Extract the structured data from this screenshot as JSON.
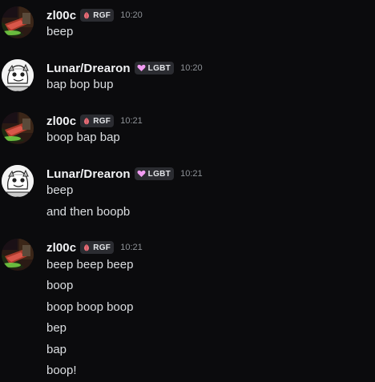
{
  "messages": [
    {
      "author": "zl00c",
      "tag": "RGF",
      "tag_icon": "peach-icon",
      "time": "10:20",
      "lines": [
        "beep"
      ]
    },
    {
      "author": "Lunar/Drearon",
      "tag": "LGBT",
      "tag_icon": "heart-icon",
      "time": "10:20",
      "lines": [
        "bap bop bup"
      ]
    },
    {
      "author": "zl00c",
      "tag": "RGF",
      "tag_icon": "peach-icon",
      "time": "10:21",
      "lines": [
        "boop bap bap"
      ]
    },
    {
      "author": "Lunar/Drearon",
      "tag": "LGBT",
      "tag_icon": "heart-icon",
      "time": "10:21",
      "lines": [
        "beep",
        "and then boopb"
      ]
    },
    {
      "author": "zl00c",
      "tag": "RGF",
      "tag_icon": "peach-icon",
      "time": "10:21",
      "lines": [
        "beep beep beep",
        "boop",
        "boop boop boop",
        "bep",
        "bap",
        "boop!"
      ]
    }
  ],
  "colors": {
    "background": "#0b0b0d",
    "username": "#f2f3f5",
    "text": "#dbdee1",
    "timestamp": "#8e9297",
    "tag_bg": "#2b2c31",
    "peach": "#e8707a",
    "heart": "#f29cf2"
  }
}
